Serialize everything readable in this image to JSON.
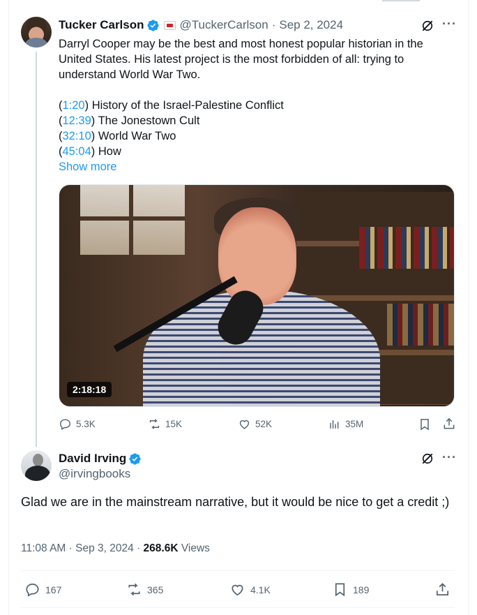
{
  "tweet": {
    "author_name": "Tucker Carlson",
    "handle": "@TuckerCarlson",
    "date": "Sep 2, 2024",
    "separator": "·",
    "text_lines": [
      "Darryl Cooper may be the best and most honest popular historian in the",
      "United States. His latest project is the most forbidden of all: trying to",
      "understand World War Two."
    ],
    "chapters": [
      {
        "time": "1:20",
        "title": ") History of the Israel-Palestine Conflict"
      },
      {
        "time": "12:39",
        "title": ") The Jonestown Cult"
      },
      {
        "time": "32:10",
        "title": ") World War Two"
      },
      {
        "time": "45:04",
        "title": ") How"
      }
    ],
    "open_paren": "(",
    "show_more": "Show more",
    "video_duration": "2:18:18",
    "stats": {
      "replies": "5.3K",
      "retweets": "15K",
      "likes": "52K",
      "views": "35M"
    }
  },
  "reply": {
    "author_name": "David Irving",
    "handle": "@irvingbooks",
    "text": "Glad we are in the mainstream narrative, but it would be nice to get a credit ;)",
    "time": "11:08 AM",
    "date": "Sep 3, 2024",
    "separator": "·",
    "views_count": "268.6K",
    "views_label": "Views",
    "stats": {
      "replies": "167",
      "retweets": "365",
      "likes": "4.1K",
      "bookmarks": "189"
    }
  },
  "icons": {
    "verified": "verified-badge-icon",
    "affiliation": "affiliation-badge-icon",
    "grok": "grok-icon",
    "more": "more-icon",
    "reply": "reply-icon",
    "retweet": "retweet-icon",
    "like": "like-icon",
    "views": "views-icon",
    "bookmark": "bookmark-icon",
    "share": "share-icon"
  },
  "more_glyph": "···",
  "colors": {
    "accent": "#1d9bf0",
    "text": "#0f1419",
    "muted": "#536471",
    "border": "#eff3f4"
  }
}
